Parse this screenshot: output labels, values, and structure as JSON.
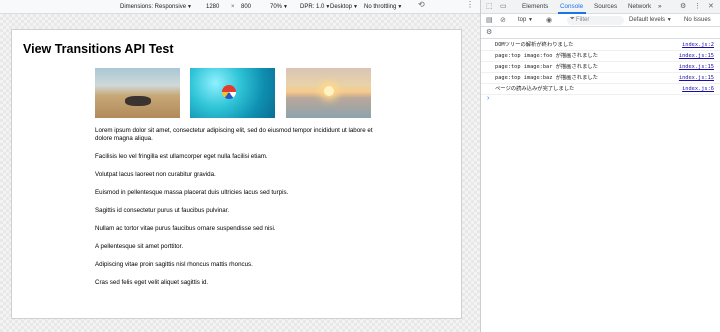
{
  "emulation_toolbar": {
    "dimensions_label": "Dimensions: Responsive",
    "width": "1280",
    "times": "×",
    "height": "800",
    "zoom": "70%",
    "dpr": "DPR: 1.0",
    "device_type": "Desktop",
    "throttling": "No throttling"
  },
  "page": {
    "title": "View Transitions API Test",
    "paragraphs": [
      "Lorem ipsum dolor sit amet, consectetur adipiscing elit, sed do eiusmod tempor incididunt ut labore et dolore magna aliqua.",
      "Facilisis leo vel fringilla est ullamcorper eget nulla facilisi etiam.",
      "Volutpat lacus laoreet non curabitur gravida.",
      "Euismod in pellentesque massa placerat duis ultricies lacus sed turpis.",
      "Sagittis id consectetur purus ut faucibus pulvinar.",
      "Nullam ac tortor vitae purus faucibus ornare suspendisse sed nisi.",
      "A pellentesque sit amet porttitor.",
      "Adipiscing vitae proin sagittis nisl rhoncus mattis rhoncus.",
      "Cras sed felis eget velit aliquet sagittis id."
    ]
  },
  "devtools": {
    "tabs": [
      "Elements",
      "Console",
      "Sources",
      "Network"
    ],
    "more_tabs": "»",
    "context": "top",
    "filter_placeholder": "Filter",
    "levels": "Default levels",
    "issues": "No Issues",
    "log": [
      {
        "message": "DOMツリーの解析が終わりました",
        "source": "index.js:2"
      },
      {
        "message": "page:top image:foo が描画されました",
        "source": "index.js:15"
      },
      {
        "message": "page:top image:bar が描画されました",
        "source": "index.js:15"
      },
      {
        "message": "page:top image:baz が描画されました",
        "source": "index.js:15"
      },
      {
        "message": "ページの読み込みが完了しました",
        "source": "index.js:6"
      }
    ],
    "prompt": "›"
  },
  "colors": {
    "accent": "#1a73e8",
    "link": "#1a0dab"
  }
}
